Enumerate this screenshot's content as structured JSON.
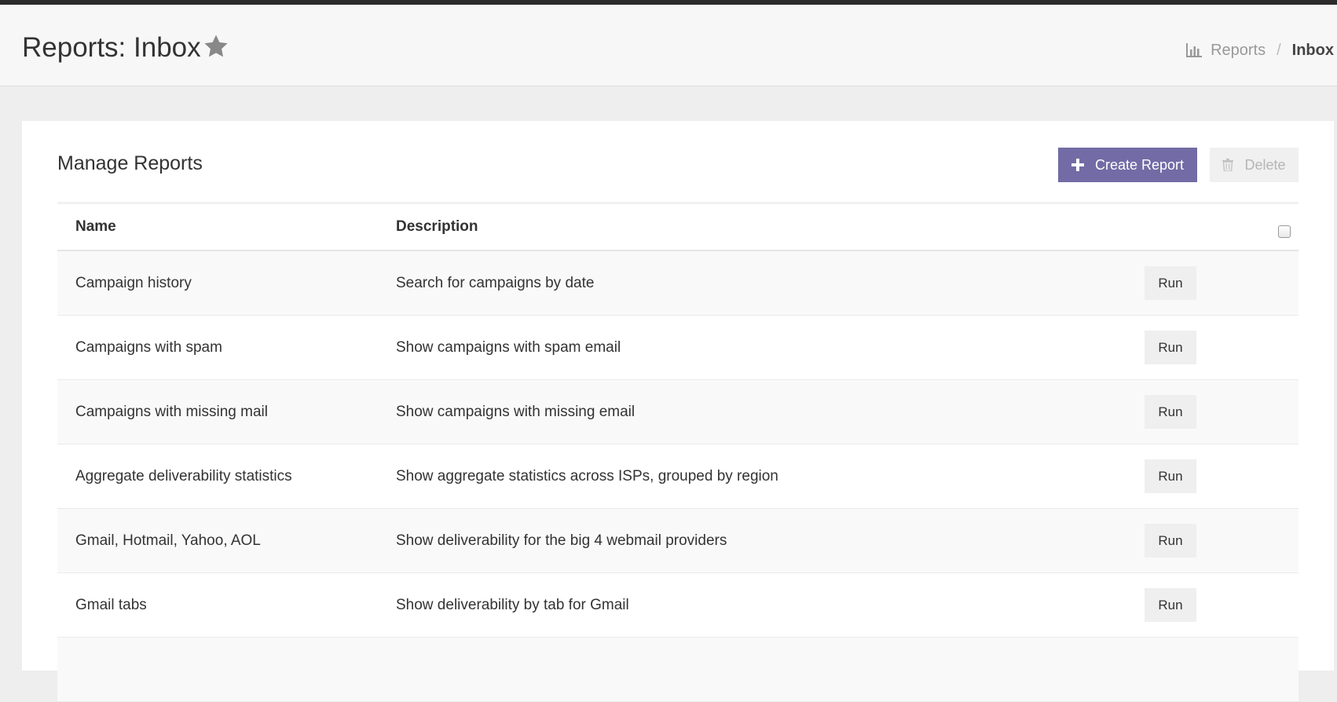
{
  "header": {
    "title": "Reports: Inbox",
    "breadcrumb": {
      "parent": "Reports",
      "separator": "/",
      "current": "Inbox"
    }
  },
  "panel": {
    "title": "Manage Reports",
    "create_label": "Create Report",
    "delete_label": "Delete"
  },
  "table": {
    "columns": {
      "name": "Name",
      "description": "Description"
    },
    "rows": [
      {
        "name": "Campaign history",
        "description": "Search for campaigns by date",
        "action": "Run"
      },
      {
        "name": "Campaigns with spam",
        "description": "Show campaigns with spam email",
        "action": "Run"
      },
      {
        "name": "Campaigns with missing mail",
        "description": "Show campaigns with missing email",
        "action": "Run"
      },
      {
        "name": "Aggregate deliverability statistics",
        "description": "Show aggregate statistics across ISPs, grouped by region",
        "action": "Run"
      },
      {
        "name": "Gmail, Hotmail, Yahoo, AOL",
        "description": "Show deliverability for the big 4 webmail providers",
        "action": "Run"
      },
      {
        "name": "Gmail tabs",
        "description": "Show deliverability by tab for Gmail",
        "action": "Run"
      },
      {
        "name": "",
        "description": "",
        "action": ""
      }
    ]
  },
  "colors": {
    "accent": "#736ba5",
    "top_bar": "#2b2b2b",
    "background": "#eeeeee",
    "row_stripe": "#f9f9f9"
  },
  "icons": {
    "favorite": "star-icon",
    "breadcrumb": "bar-chart-icon",
    "create": "plus-icon",
    "delete": "trash-icon"
  }
}
